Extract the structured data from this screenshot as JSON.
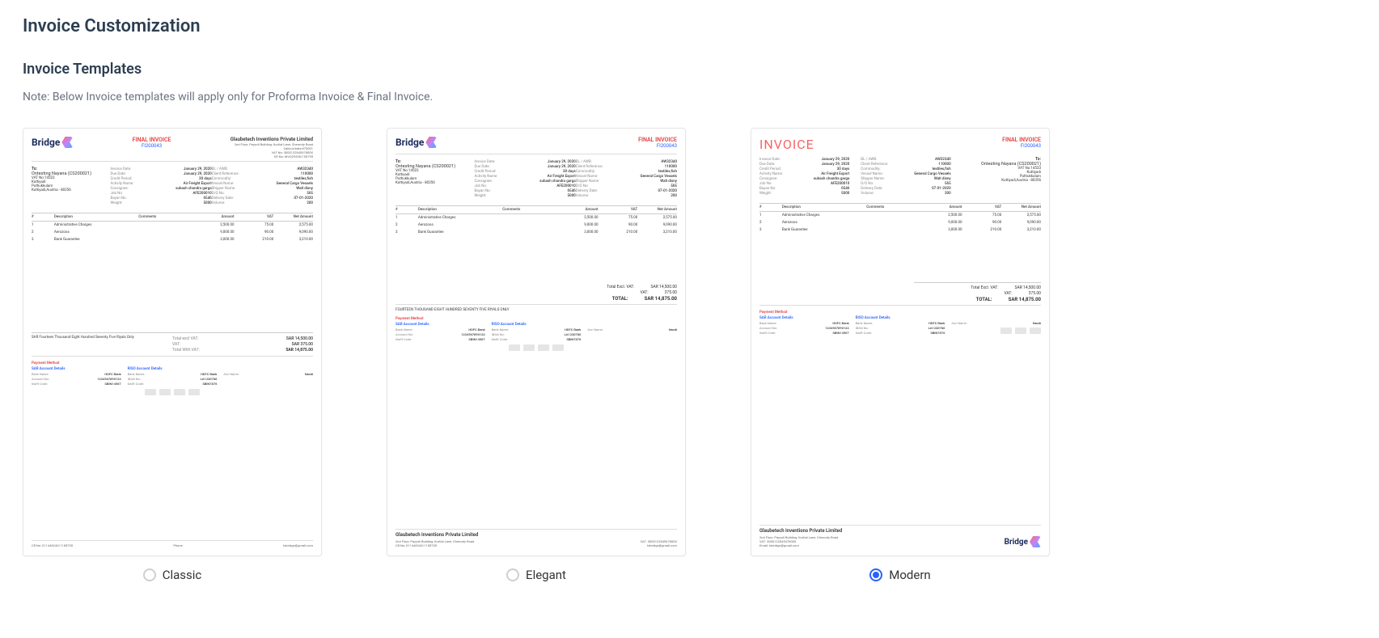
{
  "page": {
    "title": "Invoice Customization",
    "section_title": "Invoice Templates",
    "note": "Note: Below Invoice templates will apply only for Proforma Invoice & Final Invoice."
  },
  "templates": {
    "classic": {
      "label": "Classic",
      "selected": false
    },
    "elegant": {
      "label": "Elegant",
      "selected": false
    },
    "modern": {
      "label": "Modern",
      "selected": true
    }
  },
  "preview": {
    "logo_text": "Bridge",
    "final_invoice": "FINAL INVOICE",
    "invoice_no": "FI200043",
    "modern_word": "INVOICE",
    "company": {
      "name": "Glaubetech Inventions Private Limited",
      "addr1": "2nd Floor, Payyoli Building, Kurtial Lane, Cherooty Road",
      "addr2": "Calicut,India-673001",
      "vat": "VAT No: 300012284547800X",
      "cr": "CR No: MVQ29208/100795"
    },
    "to": {
      "label": "To:",
      "name": "Ontesting Nayana (CS200021)",
      "vat": "VAT No:14523",
      "city": "Kuttiyadi",
      "place": "Puthukkulam",
      "country": "Kuttiyadi,Austria - 80356"
    },
    "fields": {
      "invoice_date_k": "Invoice Date:",
      "invoice_date_v": "January 29, 2020",
      "due_date_k": "Due Date:",
      "due_date_v": "January 29, 2020",
      "credit_period_k": "Credit Period:",
      "credit_period_v": "30 days",
      "activity_k": "Activity Name:",
      "activity_v": "Air Freight Export",
      "consignee_k": "Consignee:",
      "consignee_v": "subash chandra garga",
      "job_k": "Job No:",
      "job_v": "AFE200010",
      "bayan_k": "Bayan No:",
      "bayan_v": "6546",
      "weight_k": "Weight:",
      "weight_v": "5000",
      "bl_k": "BL / AWB:",
      "bl_v": "AW32340",
      "client_ref_k": "Client Reference:",
      "client_ref_v": "110000",
      "commodity_k": "Commodity:",
      "commodity_v": "textiles,fish",
      "vessel_k": "Vessel Name:",
      "vessel_v": "General Cargo Vessels",
      "shipper_k": "Shipper Name:",
      "shipper_v": "Walt disny",
      "do_k": "D/O No:",
      "do_v": "565",
      "delivery_k": "Delivery Date:",
      "delivery_v": "07-01-2020",
      "volume_k": "Volume:",
      "volume_v": "200"
    },
    "table": {
      "h_idx": "#",
      "h_desc": "Description",
      "h_cmt": "Comments",
      "h_amt": "Amount",
      "h_vat": "VAT",
      "h_net": "Net Amount",
      "r1_idx": "1",
      "r1_desc": "Administrative Charges",
      "r1_amt": "2,500.00",
      "r1_vat": "75.00",
      "r1_net": "2,575.00",
      "r2_idx": "2",
      "r2_desc": "Aerozoos",
      "r2_amt": "9,000.00",
      "r2_vat": "90.00",
      "r2_net": "9,090.00",
      "r3_idx": "3",
      "r3_desc": "Bank Guarantee",
      "r3_amt": "3,000.00",
      "r3_vat": "210.00",
      "r3_net": "3,210.00"
    },
    "totals": {
      "words_classic": "SAR Fourteen Thousand Eight Hundred Seventy Five Riyals Only",
      "words_elegant": "FOURTEEN THOUSAND EIGHT HUNDRED SEVENTY FIVE RIYALS ONLY",
      "excl_k": "Total excl VAT:",
      "excl_v": "SAR 14,500.00",
      "excl_k2": "Total Excl. VAT:",
      "excl_v2": "SAR 14,500.00",
      "vat_k": "VAT:",
      "vat_v": "SAR 375.00",
      "vat_v2": "375.00",
      "incl_k": "Total With VAT:",
      "incl_v": "SAR 14,875.00",
      "total_k": "TOTAL:",
      "total_v": "SAR 14,875.00"
    },
    "bank": {
      "payment_method": "Payment Method",
      "sar_title": "SAR Account Details",
      "riso_title": "RISO Account Details",
      "bank_name_k": "Bank Name:",
      "bank_name_v": "HDFC Bank",
      "acc_name_k": "Acc Name:",
      "acc_name_v": "Navdi",
      "acc_no_k": "Account No:",
      "acc_no_v": "1234567890123",
      "iban_k": "IBAN No:",
      "iban_v": "LA1230780",
      "swift_k": "Swift Code:",
      "swift_v": "SBIN14567",
      "swift_v2": "SBIN7876"
    },
    "footer": {
      "vat2": "VAT: 300012284547800X",
      "cr2": "CR No: 01144824X/1185735",
      "email": "tsbridge@gmail.com",
      "phone": "Phone"
    }
  }
}
